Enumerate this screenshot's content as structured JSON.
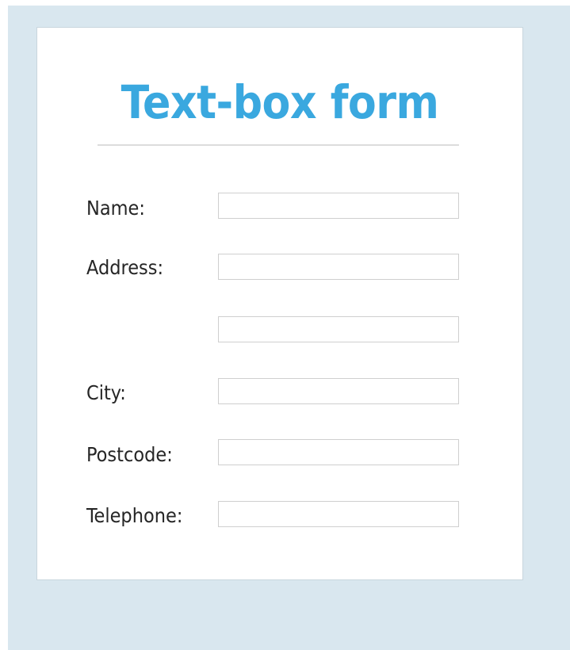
{
  "form": {
    "title": "Text-box form",
    "fields": [
      {
        "label": "Name:",
        "value": ""
      },
      {
        "label": "Address:",
        "value": ""
      },
      {
        "label": "",
        "value": ""
      },
      {
        "label": "City:",
        "value": ""
      },
      {
        "label": "Postcode:",
        "value": ""
      },
      {
        "label": "Telephone:",
        "value": ""
      }
    ]
  },
  "colors": {
    "background": "#d9e7ef",
    "card": "#ffffff",
    "title": "#3aa8df",
    "label": "#262626",
    "input_border": "#cfcfcf"
  }
}
